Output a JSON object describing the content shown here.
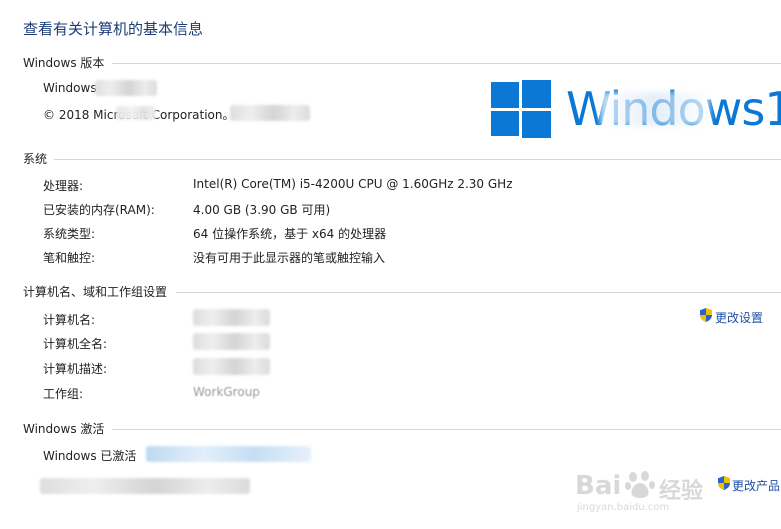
{
  "page": {
    "title": "查看有关计算机的基本信息"
  },
  "edition": {
    "section_title": "Windows 版本",
    "os_name": "Windows",
    "copyright": "© 2018 Microsoft Corporation。",
    "logo_text": "Windows1"
  },
  "system": {
    "section_title": "系统",
    "rows": [
      {
        "label": "处理器:",
        "value": "Intel(R) Core(TM) i5-4200U CPU @ 1.60GHz   2.30 GHz"
      },
      {
        "label": "已安装的内存(RAM):",
        "value": "4.00 GB (3.90 GB 可用)"
      },
      {
        "label": "系统类型:",
        "value": "64 位操作系统，基于 x64 的处理器"
      },
      {
        "label": "笔和触控:",
        "value": "没有可用于此显示器的笔或触控输入"
      }
    ]
  },
  "computer": {
    "section_title": "计算机名、域和工作组设置",
    "labels": {
      "name": "计算机名:",
      "full_name": "计算机全名:",
      "description": "计算机描述:",
      "workgroup": "工作组:"
    },
    "workgroup_value": "WorkGroup",
    "change_settings": "更改设置"
  },
  "activation": {
    "section_title": "Windows 激活",
    "status": "Windows 已激活",
    "change_product": "更改产品"
  },
  "watermark": {
    "brand": "Bai",
    "brand_cn": "经验",
    "url": "jingyan.baidu.com"
  },
  "colors": {
    "accent": "#0a78d4",
    "title": "#1c3c78",
    "link": "#1f4fa6"
  },
  "icons": {
    "settings_shield": "uac-shield-icon",
    "product_shield": "uac-shield-icon",
    "windows_logo": "windows-logo-icon"
  }
}
